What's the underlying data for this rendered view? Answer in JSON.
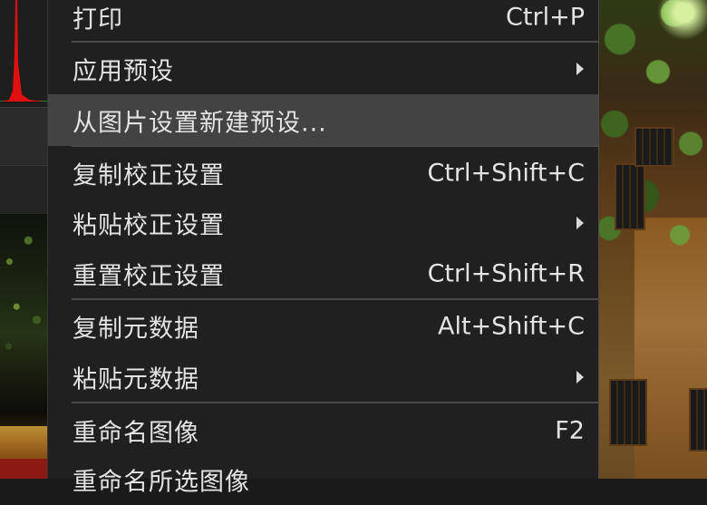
{
  "menu": {
    "items": [
      {
        "label": "打印",
        "shortcut": "Ctrl+P"
      },
      {
        "label": "应用预设",
        "submenu": true
      },
      {
        "label": "从图片设置新建预设...",
        "highlighted": true
      },
      {
        "label": "复制校正设置",
        "shortcut": "Ctrl+Shift+C"
      },
      {
        "label": "粘贴校正设置",
        "submenu": true
      },
      {
        "label": "重置校正设置",
        "shortcut": "Ctrl+Shift+R"
      },
      {
        "label": "复制元数据",
        "shortcut": "Alt+Shift+C"
      },
      {
        "label": "粘贴元数据",
        "submenu": true
      },
      {
        "label": "重命名图像",
        "shortcut": "F2"
      },
      {
        "label": "重命名所选图像"
      }
    ]
  },
  "colors": {
    "menu_background": "#202021",
    "highlight": "#434344",
    "text": "#e3e3e3",
    "histogram_spike": "#e01010"
  }
}
